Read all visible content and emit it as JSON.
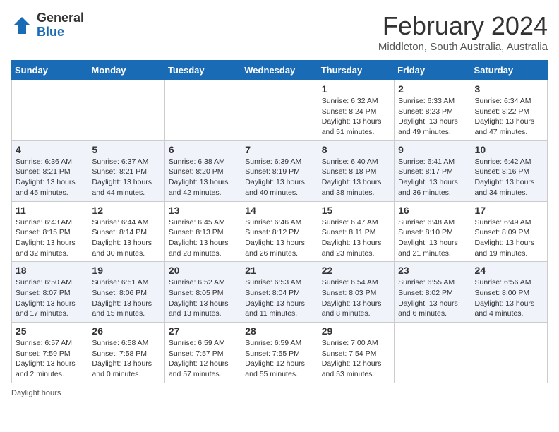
{
  "header": {
    "logo_general": "General",
    "logo_blue": "Blue",
    "month_title": "February 2024",
    "location": "Middleton, South Australia, Australia"
  },
  "days_of_week": [
    "Sunday",
    "Monday",
    "Tuesday",
    "Wednesday",
    "Thursday",
    "Friday",
    "Saturday"
  ],
  "weeks": [
    [
      {
        "day": "",
        "info": ""
      },
      {
        "day": "",
        "info": ""
      },
      {
        "day": "",
        "info": ""
      },
      {
        "day": "",
        "info": ""
      },
      {
        "day": "1",
        "info": "Sunrise: 6:32 AM\nSunset: 8:24 PM\nDaylight: 13 hours and 51 minutes."
      },
      {
        "day": "2",
        "info": "Sunrise: 6:33 AM\nSunset: 8:23 PM\nDaylight: 13 hours and 49 minutes."
      },
      {
        "day": "3",
        "info": "Sunrise: 6:34 AM\nSunset: 8:22 PM\nDaylight: 13 hours and 47 minutes."
      }
    ],
    [
      {
        "day": "4",
        "info": "Sunrise: 6:36 AM\nSunset: 8:21 PM\nDaylight: 13 hours and 45 minutes."
      },
      {
        "day": "5",
        "info": "Sunrise: 6:37 AM\nSunset: 8:21 PM\nDaylight: 13 hours and 44 minutes."
      },
      {
        "day": "6",
        "info": "Sunrise: 6:38 AM\nSunset: 8:20 PM\nDaylight: 13 hours and 42 minutes."
      },
      {
        "day": "7",
        "info": "Sunrise: 6:39 AM\nSunset: 8:19 PM\nDaylight: 13 hours and 40 minutes."
      },
      {
        "day": "8",
        "info": "Sunrise: 6:40 AM\nSunset: 8:18 PM\nDaylight: 13 hours and 38 minutes."
      },
      {
        "day": "9",
        "info": "Sunrise: 6:41 AM\nSunset: 8:17 PM\nDaylight: 13 hours and 36 minutes."
      },
      {
        "day": "10",
        "info": "Sunrise: 6:42 AM\nSunset: 8:16 PM\nDaylight: 13 hours and 34 minutes."
      }
    ],
    [
      {
        "day": "11",
        "info": "Sunrise: 6:43 AM\nSunset: 8:15 PM\nDaylight: 13 hours and 32 minutes."
      },
      {
        "day": "12",
        "info": "Sunrise: 6:44 AM\nSunset: 8:14 PM\nDaylight: 13 hours and 30 minutes."
      },
      {
        "day": "13",
        "info": "Sunrise: 6:45 AM\nSunset: 8:13 PM\nDaylight: 13 hours and 28 minutes."
      },
      {
        "day": "14",
        "info": "Sunrise: 6:46 AM\nSunset: 8:12 PM\nDaylight: 13 hours and 26 minutes."
      },
      {
        "day": "15",
        "info": "Sunrise: 6:47 AM\nSunset: 8:11 PM\nDaylight: 13 hours and 23 minutes."
      },
      {
        "day": "16",
        "info": "Sunrise: 6:48 AM\nSunset: 8:10 PM\nDaylight: 13 hours and 21 minutes."
      },
      {
        "day": "17",
        "info": "Sunrise: 6:49 AM\nSunset: 8:09 PM\nDaylight: 13 hours and 19 minutes."
      }
    ],
    [
      {
        "day": "18",
        "info": "Sunrise: 6:50 AM\nSunset: 8:07 PM\nDaylight: 13 hours and 17 minutes."
      },
      {
        "day": "19",
        "info": "Sunrise: 6:51 AM\nSunset: 8:06 PM\nDaylight: 13 hours and 15 minutes."
      },
      {
        "day": "20",
        "info": "Sunrise: 6:52 AM\nSunset: 8:05 PM\nDaylight: 13 hours and 13 minutes."
      },
      {
        "day": "21",
        "info": "Sunrise: 6:53 AM\nSunset: 8:04 PM\nDaylight: 13 hours and 11 minutes."
      },
      {
        "day": "22",
        "info": "Sunrise: 6:54 AM\nSunset: 8:03 PM\nDaylight: 13 hours and 8 minutes."
      },
      {
        "day": "23",
        "info": "Sunrise: 6:55 AM\nSunset: 8:02 PM\nDaylight: 13 hours and 6 minutes."
      },
      {
        "day": "24",
        "info": "Sunrise: 6:56 AM\nSunset: 8:00 PM\nDaylight: 13 hours and 4 minutes."
      }
    ],
    [
      {
        "day": "25",
        "info": "Sunrise: 6:57 AM\nSunset: 7:59 PM\nDaylight: 13 hours and 2 minutes."
      },
      {
        "day": "26",
        "info": "Sunrise: 6:58 AM\nSunset: 7:58 PM\nDaylight: 13 hours and 0 minutes."
      },
      {
        "day": "27",
        "info": "Sunrise: 6:59 AM\nSunset: 7:57 PM\nDaylight: 12 hours and 57 minutes."
      },
      {
        "day": "28",
        "info": "Sunrise: 6:59 AM\nSunset: 7:55 PM\nDaylight: 12 hours and 55 minutes."
      },
      {
        "day": "29",
        "info": "Sunrise: 7:00 AM\nSunset: 7:54 PM\nDaylight: 12 hours and 53 minutes."
      },
      {
        "day": "",
        "info": ""
      },
      {
        "day": "",
        "info": ""
      }
    ]
  ],
  "footer": {
    "daylight_hours": "Daylight hours"
  }
}
